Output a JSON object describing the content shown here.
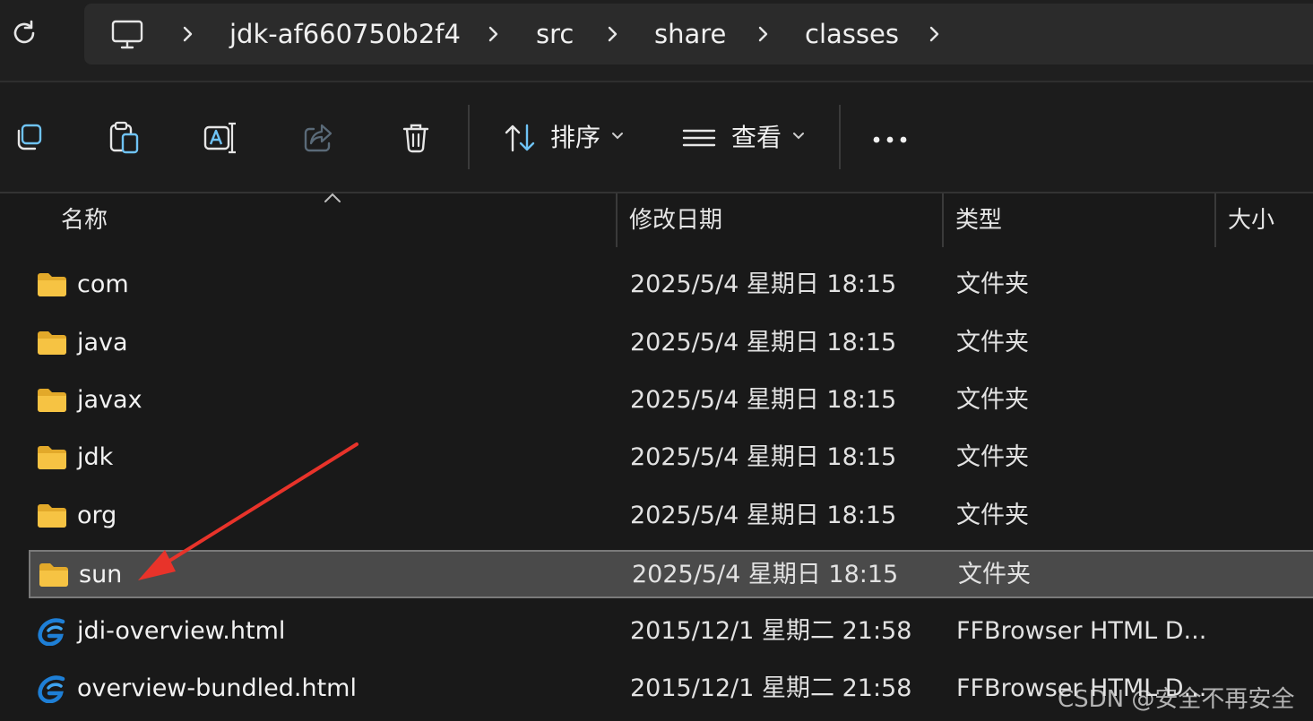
{
  "breadcrumb": {
    "items": [
      "jdk-af660750b2f4",
      "src",
      "share",
      "classes"
    ]
  },
  "toolbar": {
    "sort_label": "排序",
    "view_label": "查看",
    "more_label": "•••"
  },
  "columns": {
    "name": "名称",
    "modified": "修改日期",
    "type": "类型",
    "size": "大小"
  },
  "files": [
    {
      "name": "com",
      "modified": "2025/5/4 星期日 18:15",
      "type": "文件夹",
      "icon": "folder-icon"
    },
    {
      "name": "java",
      "modified": "2025/5/4 星期日 18:15",
      "type": "文件夹",
      "icon": "folder-icon"
    },
    {
      "name": "javax",
      "modified": "2025/5/4 星期日 18:15",
      "type": "文件夹",
      "icon": "folder-icon"
    },
    {
      "name": "jdk",
      "modified": "2025/5/4 星期日 18:15",
      "type": "文件夹",
      "icon": "folder-icon"
    },
    {
      "name": "org",
      "modified": "2025/5/4 星期日 18:15",
      "type": "文件夹",
      "icon": "folder-icon"
    },
    {
      "name": "sun",
      "modified": "2025/5/4 星期日 18:15",
      "type": "文件夹",
      "icon": "folder-icon",
      "selected": true
    },
    {
      "name": "jdi-overview.html",
      "modified": "2015/12/1 星期二 21:58",
      "type": "FFBrowser HTML D...",
      "icon": "browser-html-icon"
    },
    {
      "name": "overview-bundled.html",
      "modified": "2015/12/1 星期二 21:58",
      "type": "FFBrowser HTML D...",
      "icon": "browser-html-icon"
    }
  ],
  "watermark": "CSDN @安全不再安全",
  "colors": {
    "folder": "#f6c343",
    "selection": "#4a4a4a",
    "annotation_arrow": "#e8332a",
    "browser_icon": "#1e7fd6"
  }
}
